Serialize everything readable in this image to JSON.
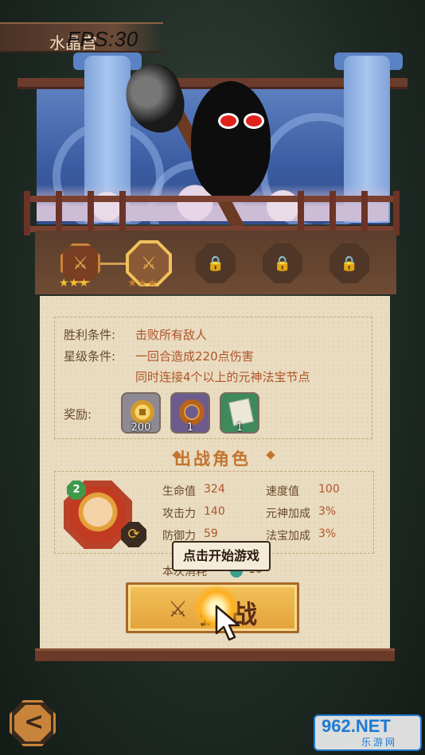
{
  "header": {
    "stage_name": "水晶宫",
    "fps_text": "FPS:30"
  },
  "progress": {
    "nodes": [
      {
        "state": "done",
        "stars": 3
      },
      {
        "state": "current",
        "stars": 3
      },
      {
        "state": "locked"
      },
      {
        "state": "locked"
      },
      {
        "state": "locked"
      }
    ],
    "star_glyph": "★★★",
    "lock_glyph": "🔒",
    "done_glyph": "⚔"
  },
  "conditions": {
    "victory_label": "胜利条件:",
    "victory_value": "击败所有敌人",
    "star_label": "星级条件:",
    "star_value_1": "一回合造成220点伤害",
    "star_value_2": "同时连接4个以上的元神法宝节点",
    "reward_label": "奖励:",
    "rewards": [
      {
        "name": "coin-icon",
        "count": "200",
        "bg": "#8e8a94"
      },
      {
        "name": "ring-icon",
        "count": "1",
        "bg": "#6c5c8e"
      },
      {
        "name": "scroll-icon",
        "count": "1",
        "bg": "#3e8a5a"
      }
    ]
  },
  "hero_section": {
    "title": "出战角色",
    "level": "2",
    "stats": {
      "hp_label": "生命值",
      "hp_value": "324",
      "speed_label": "速度值",
      "speed_value": "100",
      "atk_label": "攻击力",
      "atk_value": "140",
      "spirit_label": "元神加成",
      "spirit_value": "3%",
      "def_label": "防御力",
      "def_value": "59",
      "treasure_label": "法宝加成",
      "treasure_value": "3%"
    },
    "cost_label": "本次消耗",
    "cost_value": "10"
  },
  "battle_button": {
    "label": "挑战"
  },
  "tooltip": {
    "text": "点击开始游戏"
  },
  "back_button": {
    "glyph": "<"
  },
  "watermark": {
    "top": "962.NET",
    "bottom": "乐游网"
  },
  "colors": {
    "accent": "#c3742e",
    "panel": "#e9dcc0",
    "frame": "#6b3a28",
    "button": "#e8a83e"
  }
}
